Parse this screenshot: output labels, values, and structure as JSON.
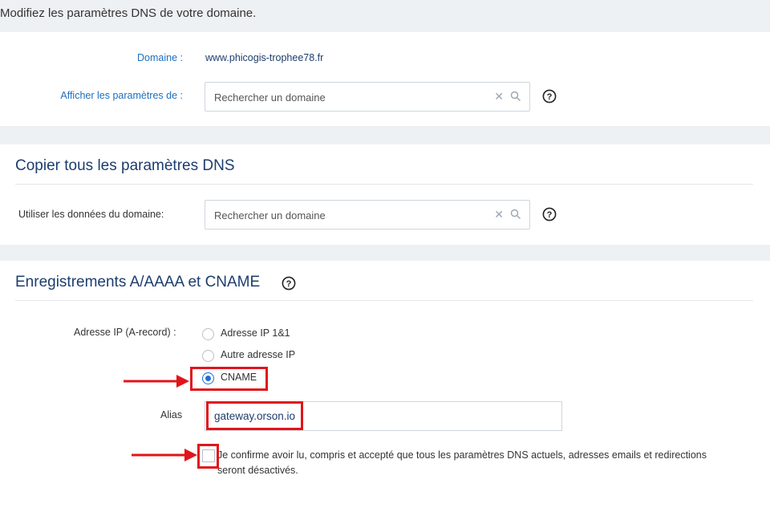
{
  "page": {
    "title": "Modifiez les paramètres DNS de votre domaine."
  },
  "domain_section": {
    "domain_label": "Domaine :",
    "domain_value": "www.phicogis-trophee78.fr",
    "show_settings_label": "Afficher les paramètres de :",
    "search_placeholder": "Rechercher un domaine"
  },
  "copy_section": {
    "title": "Copier tous les paramètres DNS",
    "use_data_label": "Utiliser les données du domaine:",
    "search_placeholder": "Rechercher un domaine"
  },
  "records_section": {
    "title": "Enregistrements A/AAAA et CNAME",
    "ip_label": "Adresse IP (A-record) :",
    "options": [
      {
        "label": "Adresse IP 1&1",
        "checked": false
      },
      {
        "label": "Autre adresse IP",
        "checked": false
      },
      {
        "label": "CNAME",
        "checked": true
      }
    ],
    "alias_label": "Alias",
    "alias_value": "gateway.orson.io",
    "confirm_text": "Je confirme avoir lu, compris et accepté que tous les paramètres DNS actuels, adresses emails et redirections seront désactivés.",
    "confirm_checked": false
  },
  "colors": {
    "accent": "#1a6fd6",
    "highlight": "#e0151b",
    "title_navy": "#1d3d6e",
    "label_blue": "#1d6fc0"
  },
  "icons": [
    "clear-icon",
    "search-icon",
    "help-icon",
    "arrow-right-icon"
  ]
}
